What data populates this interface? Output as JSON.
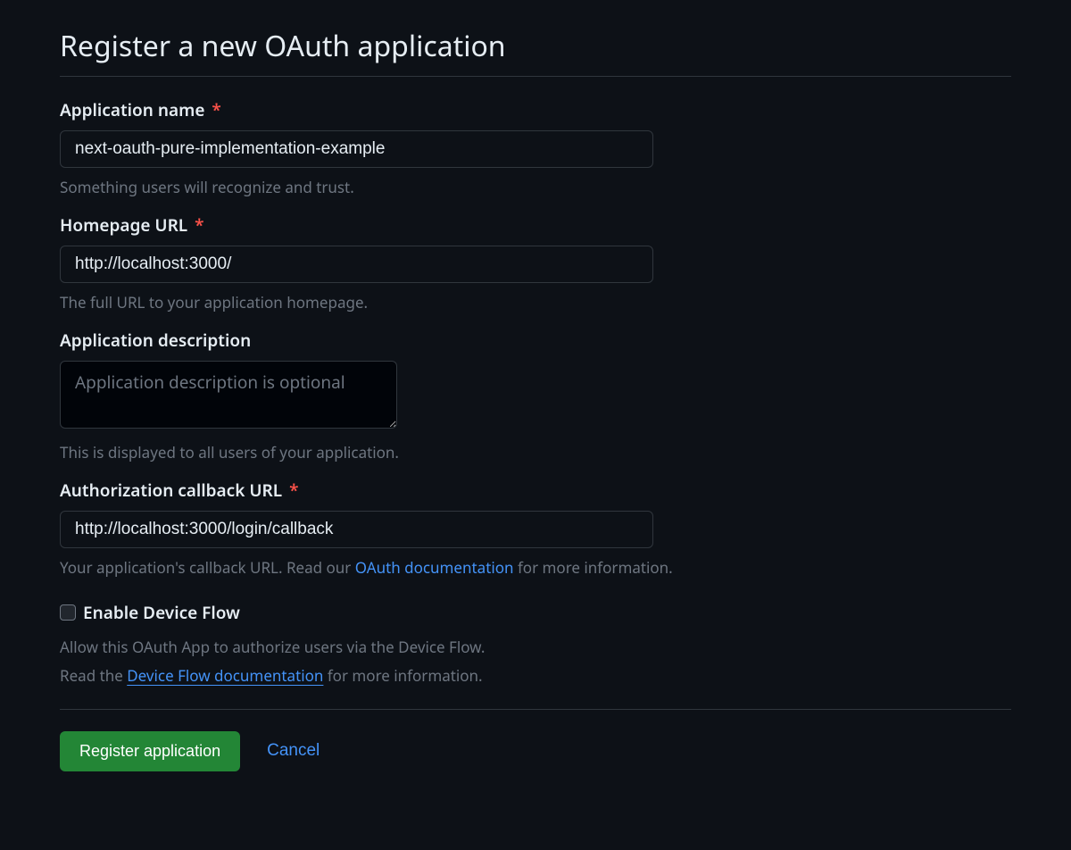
{
  "title": "Register a new OAuth application",
  "fields": {
    "app_name": {
      "label": "Application name",
      "value": "next-oauth-pure-implementation-example",
      "hint": "Something users will recognize and trust."
    },
    "homepage_url": {
      "label": "Homepage URL",
      "value": "http://localhost:3000/",
      "hint": "The full URL to your application homepage."
    },
    "app_description": {
      "label": "Application description",
      "placeholder": "Application description is optional",
      "value": "",
      "hint": "This is displayed to all users of your application."
    },
    "callback_url": {
      "label": "Authorization callback URL",
      "value": "http://localhost:3000/login/callback",
      "hint_prefix": "Your application's callback URL. Read our ",
      "hint_link": "OAuth documentation",
      "hint_suffix": " for more information."
    },
    "device_flow": {
      "label": "Enable Device Flow",
      "line1": "Allow this OAuth App to authorize users via the Device Flow.",
      "line2_prefix": "Read the ",
      "line2_link": "Device Flow documentation",
      "line2_suffix": " for more information."
    }
  },
  "buttons": {
    "register": "Register application",
    "cancel": "Cancel"
  },
  "required_marker": "*"
}
